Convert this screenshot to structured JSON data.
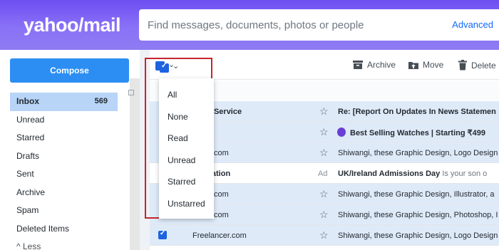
{
  "header": {
    "logo": "yahoo/mail",
    "search_placeholder": "Find messages, documents, photos or people",
    "advanced_label": "Advanced"
  },
  "sidebar": {
    "compose_label": "Compose",
    "folders": [
      {
        "label": "Inbox",
        "count": "569"
      },
      {
        "label": "Unread"
      },
      {
        "label": "Starred"
      },
      {
        "label": "Drafts"
      },
      {
        "label": "Sent"
      },
      {
        "label": "Archive"
      },
      {
        "label": "Spam"
      },
      {
        "label": "Deleted Items"
      }
    ],
    "less_label": "Less"
  },
  "toolbar": {
    "archive_label": "Archive",
    "move_label": "Move",
    "delete_label": "Delete"
  },
  "dropdown": {
    "items": [
      "All",
      "None",
      "Read",
      "Unread",
      "Starred",
      "Unstarred"
    ]
  },
  "messages": [
    {
      "sender": "omer Service",
      "subject": "Re: [Report On Updates In News Statemen"
    },
    {
      "sender": "zon",
      "subject": "Best Selling Watches | Starting ₹499"
    },
    {
      "sender": "ancer.com",
      "subject": "Shiwangi, these Graphic Design, Logo Design"
    },
    {
      "sender": "Education",
      "ad_label": "Ad",
      "subject": "UK/Ireland Admissions Day",
      "snippet": "Is your son o"
    },
    {
      "sender": "ancer.com",
      "subject": "Shiwangi, these Graphic Design, Illustrator, a"
    },
    {
      "sender": "ancer.com",
      "subject": "Shiwangi, these Graphic Design, Photoshop, I"
    },
    {
      "sender": "Freelancer.com",
      "subject": "Shiwangi, these Graphic Design, Logo Design"
    }
  ]
}
